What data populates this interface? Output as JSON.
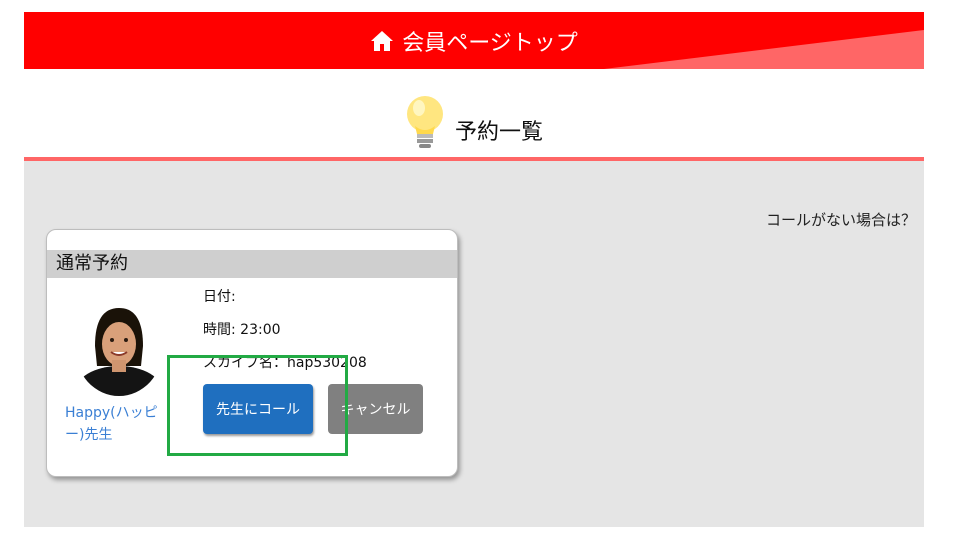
{
  "header": {
    "title": "会員ページトップ",
    "icon": "home-icon",
    "colors": {
      "background": "#ff0000",
      "accent_wedge": "#ff6666"
    }
  },
  "section": {
    "title": "予約一覧",
    "icon": "lightbulb-icon",
    "divider_color": "#ff6666"
  },
  "main": {
    "no_call_link": "コールがない場合は？"
  },
  "reservation": {
    "type_label": "通常予約",
    "teacher_name": "Happy(ハッピー)先生",
    "date_label": "日付:",
    "date_value": "",
    "time_label": "時間:",
    "time_value": "23:00",
    "skype_label": "スカイプ名：",
    "skype_value": "hap530208",
    "call_button": "先生にコール",
    "cancel_button": "キャンセル",
    "colors": {
      "call": "#1f6fbf",
      "cancel": "#808080",
      "teacher_link": "#3a7fd4"
    }
  },
  "annotation": {
    "highlight_color": "#22aa44"
  }
}
